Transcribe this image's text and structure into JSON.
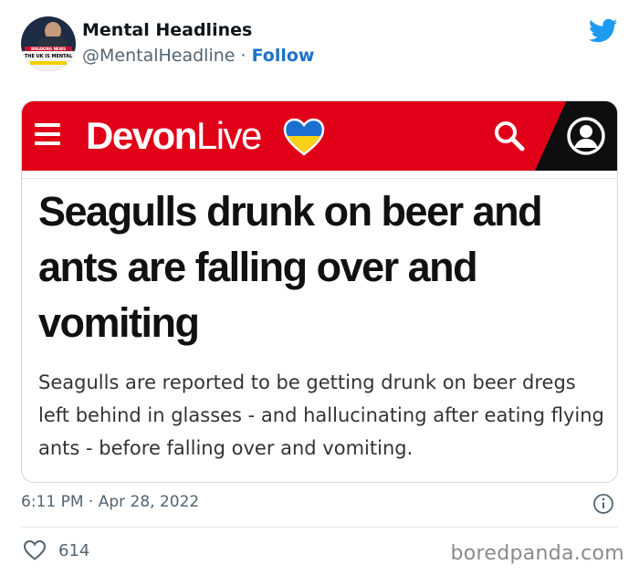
{
  "tweet": {
    "author_name": "Mental Headlines",
    "handle": "@MentalHeadline",
    "separator": " · ",
    "follow_label": "Follow",
    "avatar_banner": "BREAKING NEWS",
    "avatar_caption": "THE UK IS MENTAL",
    "timestamp": "6:11 PM · Apr 28, 2022",
    "like_count": "614"
  },
  "article": {
    "brand_bold": "Devon",
    "brand_light": "Live",
    "headline": "Seagulls drunk on beer and ants are falling over and vomiting",
    "summary": "Seagulls are reported to be getting drunk on beer dregs left behind in glasses - and hallucinating after eating flying ants - before falling over and vomiting.",
    "bar_color": "#e00018",
    "heart_colors": [
      "#1a6fd1",
      "#f7d117"
    ]
  },
  "watermark": "boredpanda.com",
  "colors": {
    "twitter_blue": "#1d9bf0",
    "follow_blue": "#1d72c9",
    "meta_gray": "#536471"
  }
}
